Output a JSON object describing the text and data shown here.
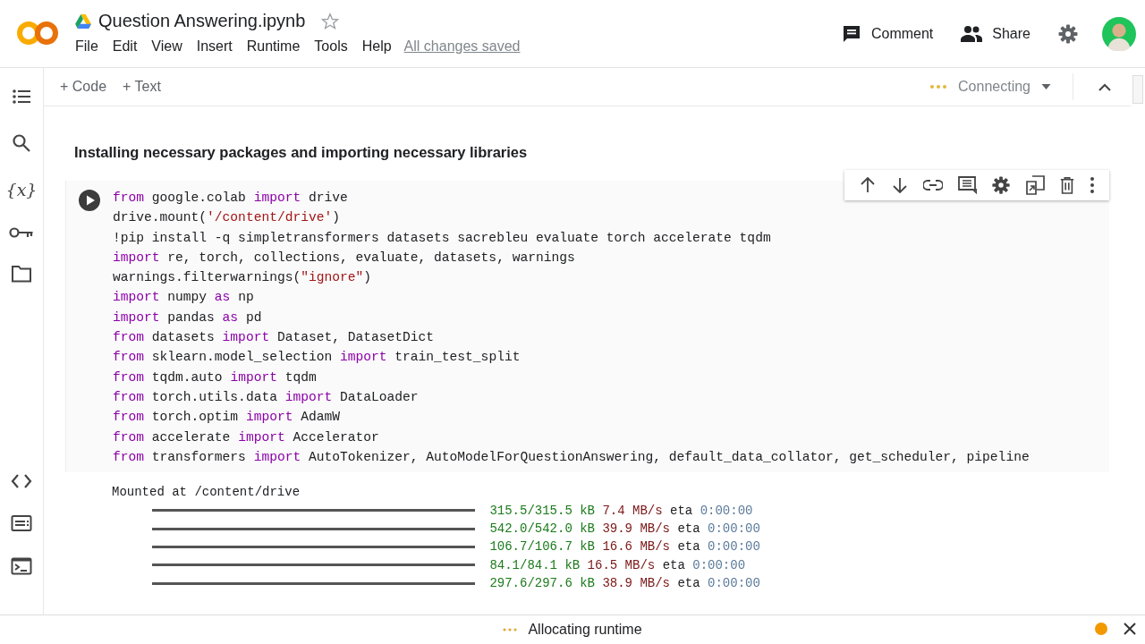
{
  "header": {
    "title": "Question Answering.ipynb",
    "starred": false,
    "menu": [
      "File",
      "Edit",
      "View",
      "Insert",
      "Runtime",
      "Tools",
      "Help"
    ],
    "save_status": "All changes saved",
    "actions": [
      {
        "kind": "comment",
        "label": "Comment"
      },
      {
        "kind": "share",
        "label": "Share"
      }
    ]
  },
  "toolbar": {
    "add_buttons": [
      {
        "icon": "+",
        "label": "Code"
      },
      {
        "icon": "+",
        "label": "Text"
      }
    ],
    "runtime_status": "Connecting"
  },
  "sidebar": {
    "top": [
      {
        "kind": "toc"
      },
      {
        "kind": "search"
      },
      {
        "kind": "variables",
        "glyph": "{x}"
      },
      {
        "kind": "key"
      },
      {
        "kind": "folder"
      }
    ],
    "bottom": [
      {
        "kind": "code"
      },
      {
        "kind": "palette"
      },
      {
        "kind": "terminal"
      }
    ]
  },
  "section_heading": "Installing necessary packages and importing necessary libraries",
  "cell_toolbar": [
    {
      "kind": "up"
    },
    {
      "kind": "down"
    },
    {
      "kind": "link"
    },
    {
      "kind": "comment"
    },
    {
      "kind": "settings"
    },
    {
      "kind": "mirror"
    },
    {
      "kind": "delete"
    },
    {
      "kind": "more"
    }
  ],
  "code_lines": [
    [
      {
        "kind": "kw",
        "text": "from"
      },
      {
        "kind": "p",
        "text": " google.colab "
      },
      {
        "kind": "kw",
        "text": "import"
      },
      {
        "kind": "p",
        "text": " drive"
      }
    ],
    [
      {
        "kind": "p",
        "text": "drive.mount("
      },
      {
        "kind": "str",
        "text": "'/content/drive'"
      },
      {
        "kind": "p",
        "text": ")"
      }
    ],
    [
      {
        "kind": "p",
        "text": "!pip install -q simpletransformers datasets sacrebleu evaluate torch accelerate tqdm"
      }
    ],
    [
      {
        "kind": "kw",
        "text": "import"
      },
      {
        "kind": "p",
        "text": " re, torch, collections, evaluate, datasets, warnings"
      }
    ],
    [
      {
        "kind": "p",
        "text": "warnings.filterwarnings("
      },
      {
        "kind": "str",
        "text": "\"ignore\""
      },
      {
        "kind": "p",
        "text": ")"
      }
    ],
    [
      {
        "kind": "kw",
        "text": "import"
      },
      {
        "kind": "p",
        "text": " numpy "
      },
      {
        "kind": "kw",
        "text": "as"
      },
      {
        "kind": "p",
        "text": " np"
      }
    ],
    [
      {
        "kind": "kw",
        "text": "import"
      },
      {
        "kind": "p",
        "text": " pandas "
      },
      {
        "kind": "kw",
        "text": "as"
      },
      {
        "kind": "p",
        "text": " pd"
      }
    ],
    [
      {
        "kind": "kw",
        "text": "from"
      },
      {
        "kind": "p",
        "text": " datasets "
      },
      {
        "kind": "kw",
        "text": "import"
      },
      {
        "kind": "p",
        "text": " Dataset, DatasetDict"
      }
    ],
    [
      {
        "kind": "kw",
        "text": "from"
      },
      {
        "kind": "p",
        "text": " sklearn.model_selection "
      },
      {
        "kind": "kw",
        "text": "import"
      },
      {
        "kind": "p",
        "text": " train_test_split"
      }
    ],
    [
      {
        "kind": "kw",
        "text": "from"
      },
      {
        "kind": "p",
        "text": " tqdm.auto "
      },
      {
        "kind": "kw",
        "text": "import"
      },
      {
        "kind": "p",
        "text": " tqdm"
      }
    ],
    [
      {
        "kind": "kw",
        "text": "from"
      },
      {
        "kind": "p",
        "text": " torch.utils.data "
      },
      {
        "kind": "kw",
        "text": "import"
      },
      {
        "kind": "p",
        "text": " DataLoader"
      }
    ],
    [
      {
        "kind": "kw",
        "text": "from"
      },
      {
        "kind": "p",
        "text": " torch.optim "
      },
      {
        "kind": "kw",
        "text": "import"
      },
      {
        "kind": "p",
        "text": " AdamW"
      }
    ],
    [
      {
        "kind": "kw",
        "text": "from"
      },
      {
        "kind": "p",
        "text": " accelerate "
      },
      {
        "kind": "kw",
        "text": "import"
      },
      {
        "kind": "p",
        "text": " Accelerator"
      }
    ],
    [
      {
        "kind": "kw",
        "text": "from"
      },
      {
        "kind": "p",
        "text": " transformers "
      },
      {
        "kind": "kw",
        "text": "import"
      },
      {
        "kind": "p",
        "text": " AutoTokenizer, AutoModelForQuestionAnswering, default_data_collator, get_scheduler, pipeline"
      }
    ]
  ],
  "output": {
    "text": "Mounted at /content/drive",
    "progress": [
      {
        "size": "315.5/315.5 kB",
        "speed": "7.4 MB/s",
        "eta": "eta",
        "time": "0:00:00"
      },
      {
        "size": "542.0/542.0 kB",
        "speed": "39.9 MB/s",
        "eta": "eta",
        "time": "0:00:00"
      },
      {
        "size": "106.7/106.7 kB",
        "speed": "16.6 MB/s",
        "eta": "eta",
        "time": "0:00:00"
      },
      {
        "size": "84.1/84.1 kB",
        "speed": "16.5 MB/s",
        "eta": "eta",
        "time": "0:00:00"
      },
      {
        "size": "297.6/297.6 kB",
        "speed": "38.9 MB/s",
        "eta": "eta",
        "time": "0:00:00"
      }
    ]
  },
  "status_bar": {
    "message": "Allocating runtime"
  }
}
